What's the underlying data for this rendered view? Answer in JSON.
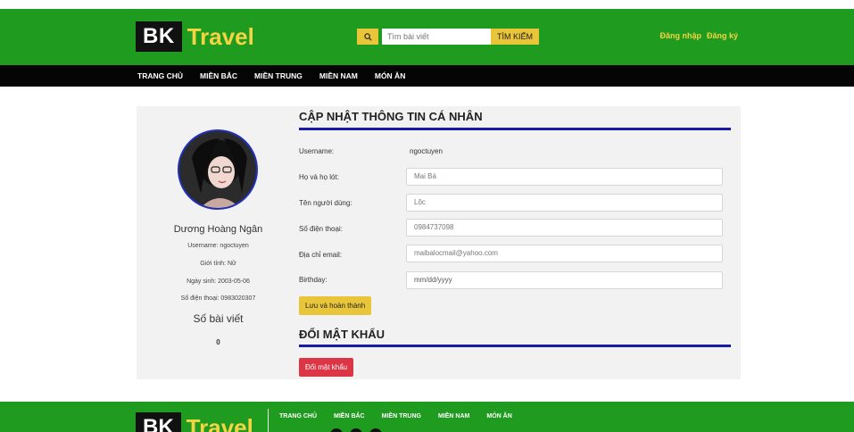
{
  "header": {
    "logo_bk": "BK",
    "logo_travel": "Travel",
    "search_placeholder": "Tìm bài viết",
    "search_button": "TÌM KIẾM",
    "login": "Đăng nhập",
    "register": "Đăng ký",
    "search_icon": "search-icon"
  },
  "nav": {
    "items": [
      "TRANG CHỦ",
      "MIỀN BẮC",
      "MIỀN TRUNG",
      "MIỀN NAM",
      "MÓN ĂN"
    ]
  },
  "profile": {
    "name": "Dương Hoàng Ngân",
    "username": "Username: ngoctuyen",
    "gender": "Giới tính: Nữ",
    "birthday": "Ngày sinh: 2003-05-06",
    "phone": "Số điện thoại: 0983020307",
    "posts_label": "Số bài viết",
    "posts_count": "0"
  },
  "form": {
    "title": "CẬP NHẬT THÔNG TIN CÁ NHÂN",
    "username_label": "Username:",
    "username_value": "ngoctuyen",
    "lastname_label": "Họ và họ lót:",
    "lastname_value": "Mai Bá",
    "firstname_label": "Tên người dùng:",
    "firstname_value": "Lộc",
    "phone_label": "Số điện thoại:",
    "phone_value": "0984737098",
    "email_label": "Địa chỉ email:",
    "email_value": "maibalocmail@yahoo.com",
    "birthday_label": "Birthday:",
    "birthday_placeholder": "mm/dd/yyyy",
    "save_button": "Lưu và hoàn thành"
  },
  "password": {
    "title": "ĐỔI MẬT KHẨU",
    "button": "Đổi mật khẩu"
  },
  "footer": {
    "logo_bk": "BK",
    "logo_travel": "Travel",
    "nav": [
      "TRANG CHỦ",
      "MIỀN BẮC",
      "MIỀN TRUNG",
      "MIỀN NAM",
      "MÓN ĂN"
    ]
  },
  "colors": {
    "brand_green": "#1f9b1f",
    "accent_yellow": "#e9c53a",
    "title_blue": "#1a1aa8",
    "danger_red": "#dc3545"
  }
}
